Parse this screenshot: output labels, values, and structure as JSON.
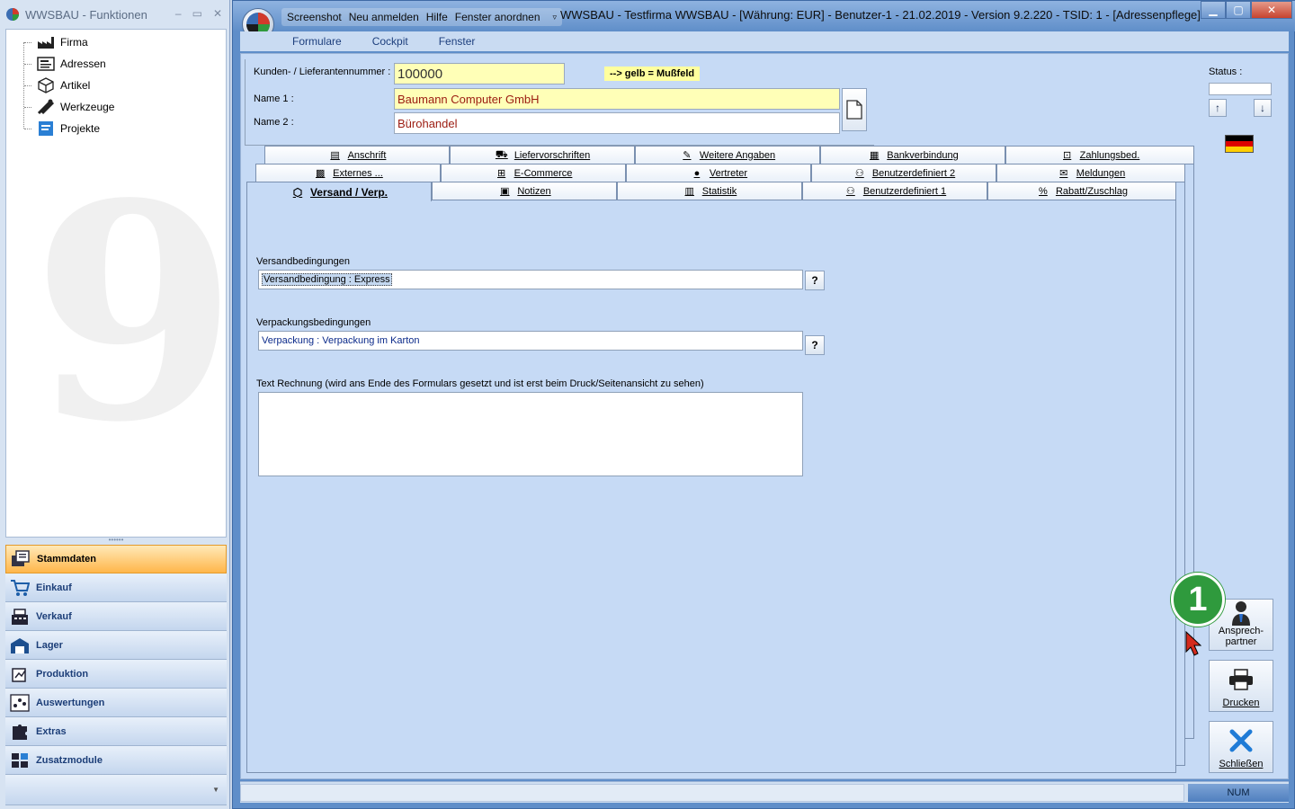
{
  "left_window": {
    "title": "WWSBAU - Funktionen",
    "tree": [
      {
        "label": "Firma",
        "icon": "factory-icon"
      },
      {
        "label": "Adressen",
        "icon": "address-card-icon"
      },
      {
        "label": "Artikel",
        "icon": "box-icon"
      },
      {
        "label": "Werkzeuge",
        "icon": "tools-icon"
      },
      {
        "label": "Projekte",
        "icon": "project-icon"
      }
    ],
    "watermark": "9",
    "nav": [
      {
        "label": "Stammdaten",
        "icon": "master-data-icon",
        "active": true
      },
      {
        "label": "Einkauf",
        "icon": "cart-icon"
      },
      {
        "label": "Verkauf",
        "icon": "cash-register-icon"
      },
      {
        "label": "Lager",
        "icon": "warehouse-icon"
      },
      {
        "label": "Produktion",
        "icon": "production-icon"
      },
      {
        "label": "Auswertungen",
        "icon": "analytics-icon"
      },
      {
        "label": "Extras",
        "icon": "puzzle-icon"
      },
      {
        "label": "Zusatzmodule",
        "icon": "modules-icon"
      }
    ]
  },
  "main_window": {
    "quick_access": [
      "Screenshot",
      "Neu anmelden",
      "Hilfe",
      "Fenster anordnen"
    ],
    "title": "WWSBAU - Testfirma WWSBAU - [Währung: EUR] - Benutzer-1 - 21.02.2019 - Version 9.2.220 - TSID: 1 - [Adressenpflege]",
    "ribbon": [
      "Formulare",
      "Cockpit",
      "Fenster"
    ]
  },
  "header": {
    "kunden_label": "Kunden- / Lieferantennummer :",
    "kunden_value": "100000",
    "legend": "--> gelb = Mußfeld",
    "name1_label": "Name 1 :",
    "name1_value": "Baumann Computer GmbH",
    "name2_label": "Name 2 :",
    "name2_value": "Bürohandel",
    "status_label": "Status :"
  },
  "tabs": {
    "row1": [
      "Anschrift",
      "Liefervorschriften",
      "Weitere Angaben",
      "Bankverbindung",
      "Zahlungsbed."
    ],
    "row2": [
      "Externes ...",
      "E-Commerce",
      "Vertreter",
      "Benutzerdefiniert 2",
      "Meldungen"
    ],
    "row3": [
      "Versand / Verp.",
      "Notizen",
      "Statistik",
      "Benutzerdefiniert 1",
      "Rabatt/Zuschlag"
    ]
  },
  "content": {
    "versand_label": "Versandbedingungen",
    "versand_value": "Versandbedingung : Express",
    "verpackung_label": "Verpackungsbedingungen",
    "verpackung_value": "Verpackung :  Verpackung im Karton",
    "text_label": "Text Rechnung (wird ans Ende des Formulars gesetzt und ist erst beim Druck/Seitenansicht zu sehen)",
    "text_value": "",
    "help_glyph": "?"
  },
  "side_buttons": {
    "ansprech": "Ansprech-\npartner",
    "drucken": "Drucken",
    "schliessen": "Schließen",
    "badge": "1"
  },
  "statusbar": {
    "num": "NUM"
  },
  "colors": {
    "active_nav": "#ffb64a",
    "badge": "#2f9a3d",
    "required_field": "#ffffb7",
    "name_text": "#9b1b10"
  }
}
